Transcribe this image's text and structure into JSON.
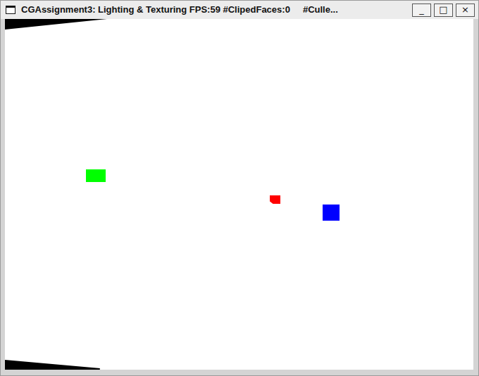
{
  "window": {
    "title": "CGAssignment3: Lighting & Texturing FPS:59 #ClipedFaces:0     #Culle...",
    "buttons": [
      "_",
      "□",
      "×"
    ]
  },
  "scene": {
    "objects": [
      {
        "color": "#00ff00"
      },
      {
        "color": "#ff0000"
      },
      {
        "color": "#0000ff"
      }
    ]
  }
}
